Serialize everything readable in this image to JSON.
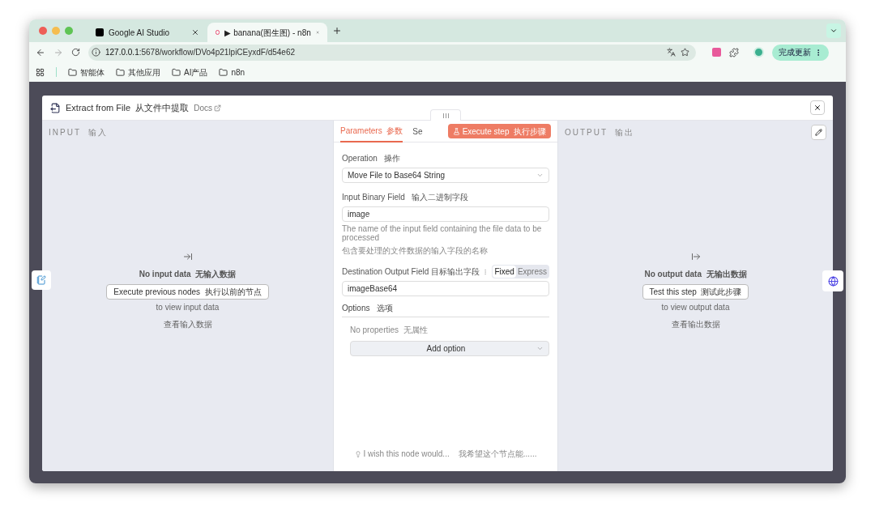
{
  "browser": {
    "tabs": [
      {
        "title": "Google AI Studio",
        "selected": false
      },
      {
        "title": "▶ banana(图生图) - n8n",
        "selected": true
      }
    ],
    "url_host": "127.0.0.1",
    "url_path": ":5678/workflow/DVo4p21lpiCEyxdF/d54e62",
    "update_button": "完成更新",
    "bookmarks": [
      "智能体",
      "其他应用",
      "AI产品",
      "n8n"
    ]
  },
  "modal": {
    "title": "Extract from File  从文件中提取",
    "docs": "Docs",
    "input": {
      "header": "INPUT  输入",
      "empty_title": "No input data  无输入数据",
      "button": "Execute previous nodes  执行以前的节点",
      "hint": "to view input data",
      "hint_cn": "查看输入数据"
    },
    "params": {
      "tabs": [
        {
          "label": "Parameters  参数",
          "selected": true
        },
        {
          "label": "Se",
          "selected": false
        }
      ],
      "execute": "Execute step  执行步骤",
      "operation_label": "Operation   操作",
      "operation_value": "Move File to Base64 String",
      "binary_label": "Input Binary Field   输入二进制字段",
      "binary_value": "image",
      "binary_help": "The name of the input field containing the file data to be processed",
      "binary_help_cn": "包含要处理的文件数据的输入字段的名称",
      "dest_label": "Destination Output Field   目标输出字段",
      "dest_modes": [
        {
          "label": "Fixed",
          "selected": true
        },
        {
          "label": "Express",
          "selected": false
        }
      ],
      "dest_value": "imageBase64",
      "options_label": "Options   选项",
      "no_props": "No properties  无属性",
      "add_option": "Add option",
      "wish": "I wish this node would...    我希望这个节点能......"
    },
    "output": {
      "header": "OUTPUT  输出",
      "empty_title": "No output data  无输出数据",
      "button": "Test this step  测试此步骤",
      "hint": "to view output data",
      "hint_cn": "查看输出数据"
    }
  }
}
